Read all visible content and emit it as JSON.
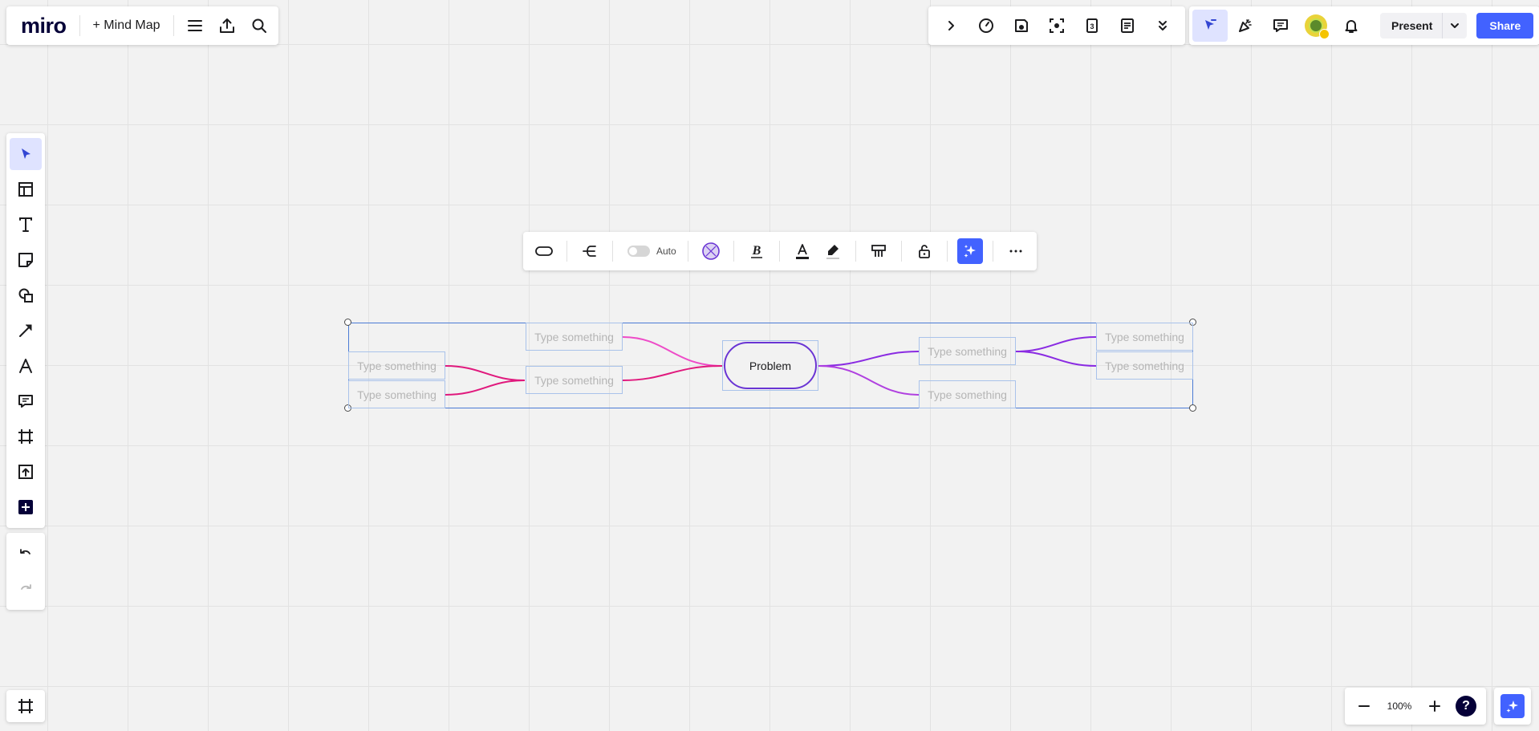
{
  "app": {
    "logo": "miro",
    "board_name": "+ Mind Map"
  },
  "top_right": {
    "present_label": "Present",
    "share_label": "Share"
  },
  "context_toolbar": {
    "auto_label": "Auto"
  },
  "zoom": {
    "value": "100%",
    "help": "?"
  },
  "mindmap": {
    "root": {
      "label": "Problem",
      "color": "#6a35d4"
    },
    "placeholder": "Type something",
    "colors": {
      "left_branch": "#e0197d",
      "left_top": "#ee4cc8",
      "right_branch": "#8a2be2",
      "right_bottom": "#b040e0"
    }
  },
  "icons": {
    "top_left": [
      "hamburger-menu-icon",
      "export-icon",
      "search-icon"
    ],
    "top_right_tools": [
      "chevron-right-icon",
      "timer-icon",
      "voting-icon",
      "focus-icon",
      "calendar-icon",
      "notes-icon",
      "chevron-double-down-icon"
    ],
    "collab": [
      "cursor-icon",
      "celebrate-icon",
      "comment-icon",
      "bell-icon"
    ],
    "left_tools": [
      "select-icon",
      "templates-icon",
      "text-icon",
      "sticky-note-icon",
      "shapes-icon",
      "line-icon",
      "pen-icon",
      "comment-icon",
      "frame-icon",
      "upload-icon",
      "more-apps-icon"
    ]
  }
}
